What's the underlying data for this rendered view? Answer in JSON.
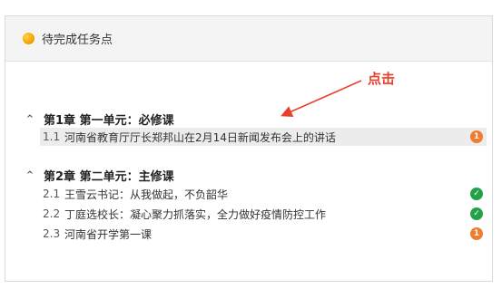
{
  "panel": {
    "title": "待完成任务点"
  },
  "annotation": {
    "text": "点击"
  },
  "chapters": [
    {
      "caret": "^",
      "title": "第1章 第一单元：必修课",
      "lessons": [
        {
          "num": "1.1",
          "title": "河南省教育厅厅长郑邦山在2月14日新闻发布会上的讲话",
          "status": "pending",
          "badge": "1"
        }
      ]
    },
    {
      "caret": "^",
      "title": "第2章 第二单元：主修课",
      "lessons": [
        {
          "num": "2.1",
          "title": "王雪云书记：从我做起，不负韶华",
          "status": "done",
          "badge": "✓"
        },
        {
          "num": "2.2",
          "title": "丁庭选校长：凝心聚力抓落实，全力做好疫情防控工作",
          "status": "done",
          "badge": "✓"
        },
        {
          "num": "2.3",
          "title": "河南省开学第一课",
          "status": "pending",
          "badge": "1"
        }
      ]
    }
  ],
  "colors": {
    "pending": "#f07c2d",
    "done": "#24a148",
    "annotation": "#e8402b"
  }
}
